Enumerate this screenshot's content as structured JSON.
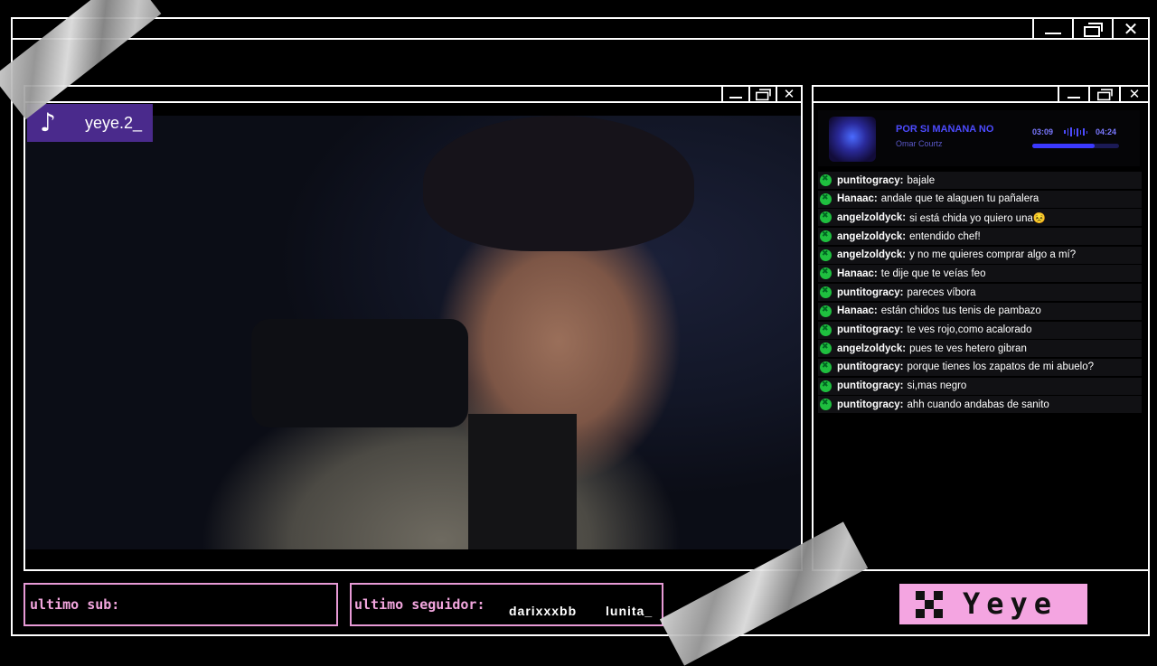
{
  "tiktok": {
    "handle": "yeye.2_"
  },
  "music": {
    "song": "POR SI MAÑANA NO",
    "artist": "Omar Courtz",
    "elapsed": "03:09",
    "duration": "04:24",
    "progress": 0.72
  },
  "chat": [
    {
      "user": "puntitogracy:",
      "text": "bajale"
    },
    {
      "user": "Hanaac:",
      "text": "andale que te alaguen tu pañalera"
    },
    {
      "user": "angelzoldyck:",
      "text": "si está chida yo quiero una😣"
    },
    {
      "user": "angelzoldyck:",
      "text": "entendido chef!"
    },
    {
      "user": "angelzoldyck:",
      "text": "y no me quieres comprar algo a mí?"
    },
    {
      "user": "Hanaac:",
      "text": "te dije que te veías feo"
    },
    {
      "user": "puntitogracy:",
      "text": "pareces víbora"
    },
    {
      "user": "Hanaac:",
      "text": "están chidos tus tenis de pambazo"
    },
    {
      "user": "puntitogracy:",
      "text": "te ves rojo,como acalorado"
    },
    {
      "user": "angelzoldyck:",
      "text": "pues te ves hetero gibran"
    },
    {
      "user": "puntitogracy:",
      "text": "porque tienes los zapatos de mi abuelo?"
    },
    {
      "user": "puntitogracy:",
      "text": "si,mas negro"
    },
    {
      "user": "puntitogracy:",
      "text": "ahh cuando andabas de sanito"
    }
  ],
  "bottom": {
    "last_sub_label": "ultimo sub:",
    "last_follower_label": "ultimo seguidor:",
    "followers": [
      "darixxxbb",
      "lunita_"
    ],
    "brand": "Yeye"
  },
  "window_icons": {
    "minimize": "minimize-icon",
    "maximize": "restore-icon",
    "close": "close-icon"
  },
  "colors": {
    "accent_pink": "#f4a5e1",
    "tiktok_purple": "#4a2a8c",
    "music_blue": "#4d4bff",
    "badge_green": "#1fbf3f"
  }
}
